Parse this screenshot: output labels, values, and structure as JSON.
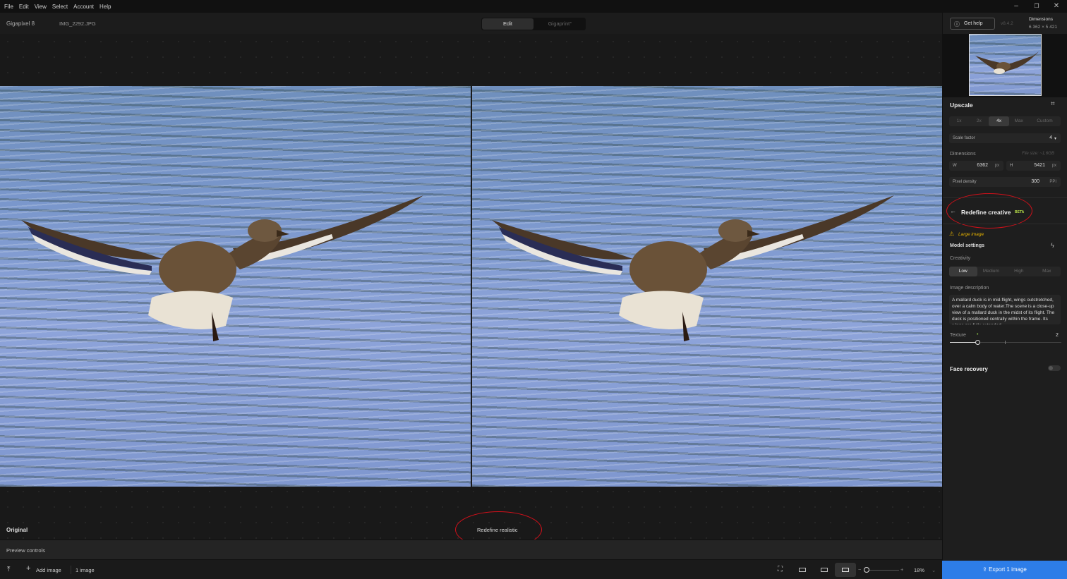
{
  "menu": [
    "File",
    "Edit",
    "View",
    "Select",
    "Account",
    "Help"
  ],
  "window": {
    "minimize": "–",
    "restore": "❐",
    "close": "✕"
  },
  "titlebar": {
    "app_name": "Gigapixel 8",
    "file_name": "IMG_2292.JPG"
  },
  "mode_tabs": {
    "edit": "Edit",
    "gigaprint": "Gigaprint°"
  },
  "header_right": {
    "get_help": "Get help",
    "version": "v8.4.2",
    "dimensions_label": "Dimensions",
    "dimensions_value": "6 362 × 5 421"
  },
  "canvas": {
    "left_label": "Original",
    "right_label": "Redefine realistic"
  },
  "preview_controls": "Preview controls",
  "bottom": {
    "add_image": "Add image",
    "count": "1 image",
    "zoom": "18%"
  },
  "panel": {
    "upscale_title": "Upscale",
    "scale_options": [
      "1x",
      "2x",
      "4x",
      "Max",
      "Custom"
    ],
    "scale_selected": "4x",
    "scale_factor_label": "Scale factor",
    "scale_factor_value": "4",
    "dimensions_label": "Dimensions",
    "file_size": "File size: ~1,6GB",
    "w_label": "W",
    "w_value": "6362",
    "w_unit": "px",
    "h_label": "H",
    "h_value": "5421",
    "h_unit": "px",
    "density_label": "Pixel density",
    "density_value": "300",
    "density_unit": "PPI",
    "model_title": "Redefine creative",
    "model_badge": "BETA",
    "warning": "Large image",
    "model_settings": "Model settings",
    "creativity_label": "Creativity",
    "creativity_options": [
      "Low",
      "Medium",
      "High",
      "Max"
    ],
    "creativity_selected": "Low",
    "desc_label": "Image description",
    "desc_text": "A mallard duck is in mid-flight, wings outstretched, over a calm body of water.The scene is a close-up view of a mallard duck in the midst of its flight. The duck is positioned centrally within the frame. Its wings are fully extended.",
    "texture_label": "Texture",
    "texture_value": "2",
    "texture_level": 0.25,
    "face_recovery": "Face recovery",
    "face_recovery_on": false
  },
  "export_label": "Export 1 image"
}
